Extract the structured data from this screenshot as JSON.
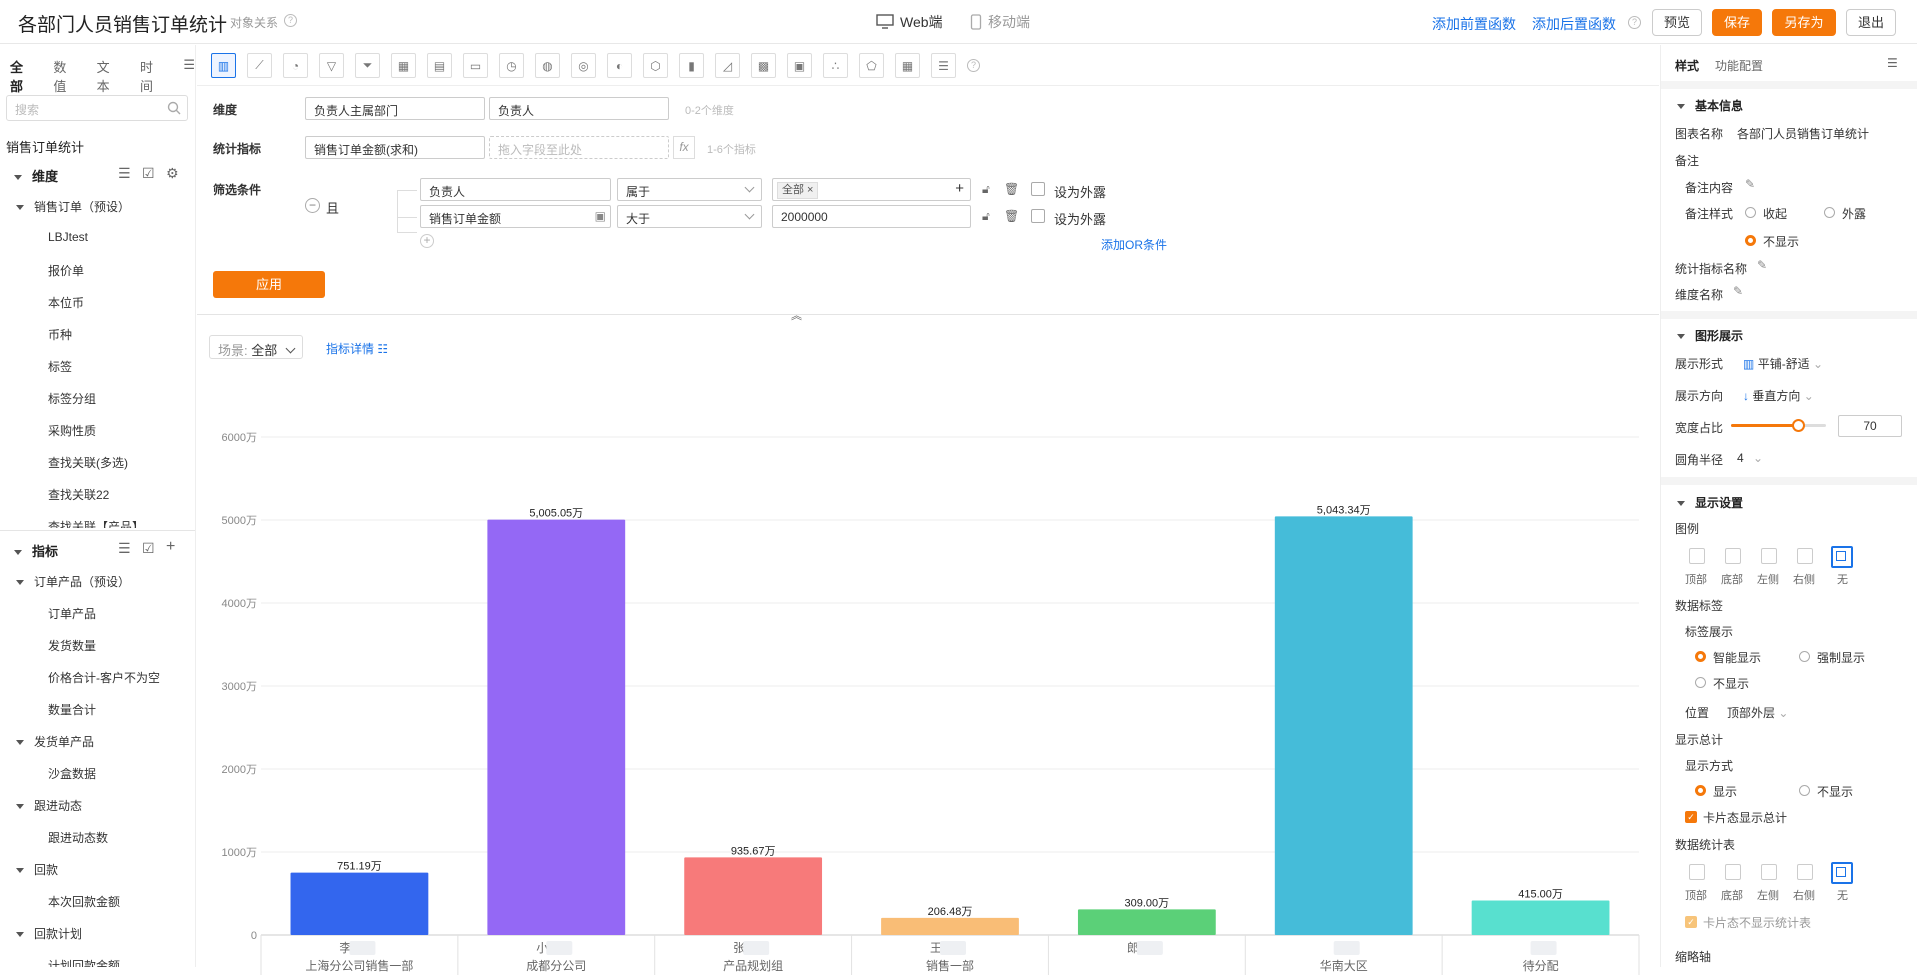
{
  "header": {
    "title": "各部门人员销售订单统计",
    "subtitle": "对象关系",
    "tab_web": "Web端",
    "tab_mobile": "移动端",
    "link_pre": "添加前置函数",
    "link_post": "添加后置函数",
    "btn_preview": "预览",
    "btn_save": "保存",
    "btn_saveas": "另存为",
    "btn_exit": "退出"
  },
  "left": {
    "tabs": [
      "全部",
      "数值",
      "文本",
      "时间"
    ],
    "search_placeholder": "搜索",
    "root": "销售订单统计",
    "dim_title": "维度",
    "dim_group": "销售订单（预设）",
    "dim_items": [
      "LBJtest",
      "报价单",
      "本位币",
      "币种",
      "标签",
      "标签分组",
      "采购性质",
      "查找关联(多选)",
      "查找关联22",
      "查找关联【产品】"
    ],
    "metric_title": "指标",
    "metric_groups": [
      {
        "name": "订单产品（预设）",
        "items": [
          "订单产品",
          "发货数量",
          "价格合计-客户不为空",
          "数量合计"
        ]
      },
      {
        "name": "发货单产品",
        "items": [
          "沙盒数据"
        ]
      },
      {
        "name": "跟进动态",
        "items": [
          "跟进动态数"
        ]
      },
      {
        "name": "回款",
        "items": [
          "本次回款金额"
        ]
      },
      {
        "name": "回款计划",
        "items": [
          "计划回款金额"
        ]
      }
    ]
  },
  "config": {
    "dimension_label": "维度",
    "dimension_fields": [
      "负责人主属部门",
      "负责人"
    ],
    "dimension_hint": "0-2个维度",
    "metric_label": "统计指标",
    "metric_field": "销售订单金额(求和)",
    "metric_drop_placeholder": "拖入字段至此处",
    "metric_hint": "1-6个指标",
    "filter_label": "筛选条件",
    "filter_logic": "且",
    "filters": [
      {
        "field": "负责人",
        "op": "属于",
        "value": "全部",
        "expose": "设为外露"
      },
      {
        "field": "销售订单金额",
        "op": "大于",
        "value": "2000000",
        "expose": "设为外露"
      }
    ],
    "add_or": "添加OR条件",
    "apply": "应用",
    "scene_key": "场景:",
    "scene_value": "全部",
    "metric_detail": "指标详情"
  },
  "chart_data": {
    "type": "bar",
    "yticks": [
      "0",
      "1000万",
      "2000万",
      "3000万",
      "4000万",
      "5000万",
      "6000万"
    ],
    "ylim": [
      0,
      6000
    ],
    "categories": [
      "上海分公司销售一部",
      "成都分公司",
      "产品规划组",
      "销售一部",
      "",
      "华南大区",
      "待分配"
    ],
    "person_initials": [
      "李",
      "小",
      "张",
      "王",
      "郎",
      "",
      ""
    ],
    "values": [
      751.19,
      5005.05,
      935.67,
      206.48,
      309.0,
      5043.34,
      415.0
    ],
    "labels": [
      "751.19万",
      "5,005.05万",
      "935.67万",
      "206.48万",
      "309.00万",
      "5,043.34万",
      "415.00万"
    ],
    "colors": [
      "#3366ee",
      "#9468f5",
      "#f77a7a",
      "#f9bd76",
      "#5bd078",
      "#45bcd9",
      "#58e0cf"
    ]
  },
  "right": {
    "tab_style": "样式",
    "tab_func": "功能配置",
    "basic": "基本信息",
    "chart_name_label": "图表名称",
    "chart_name": "各部门人员销售订单统计",
    "remark": "备注",
    "remark_content": "备注内容",
    "remark_style": "备注样式",
    "collapse": "收起",
    "expose": "外露",
    "no_show": "不显示",
    "metric_name": "统计指标名称",
    "dim_name": "维度名称",
    "graphic": "图形展示",
    "display_form_label": "展示形式",
    "display_form": "平铺-舒适",
    "direction_label": "展示方向",
    "direction": "垂直方向",
    "width_label": "宽度占比",
    "width_value": "70",
    "width_pct": 0.7,
    "radius_label": "圆角半径",
    "radius_value": "4",
    "display_settings": "显示设置",
    "legend": "图例",
    "positions": [
      "顶部",
      "底部",
      "左侧",
      "右侧",
      "无"
    ],
    "data_label": "数据标签",
    "label_show": "标签展示",
    "smart": "智能显示",
    "force": "强制显示",
    "position_label": "位置",
    "position_value": "顶部外层",
    "total": "显示总计",
    "show_mode": "显示方式",
    "show": "显示",
    "card_total": "卡片态显示总计",
    "stat_table": "数据统计表",
    "card_no_table": "卡片态不显示统计表",
    "thumb": "缩略轴"
  }
}
